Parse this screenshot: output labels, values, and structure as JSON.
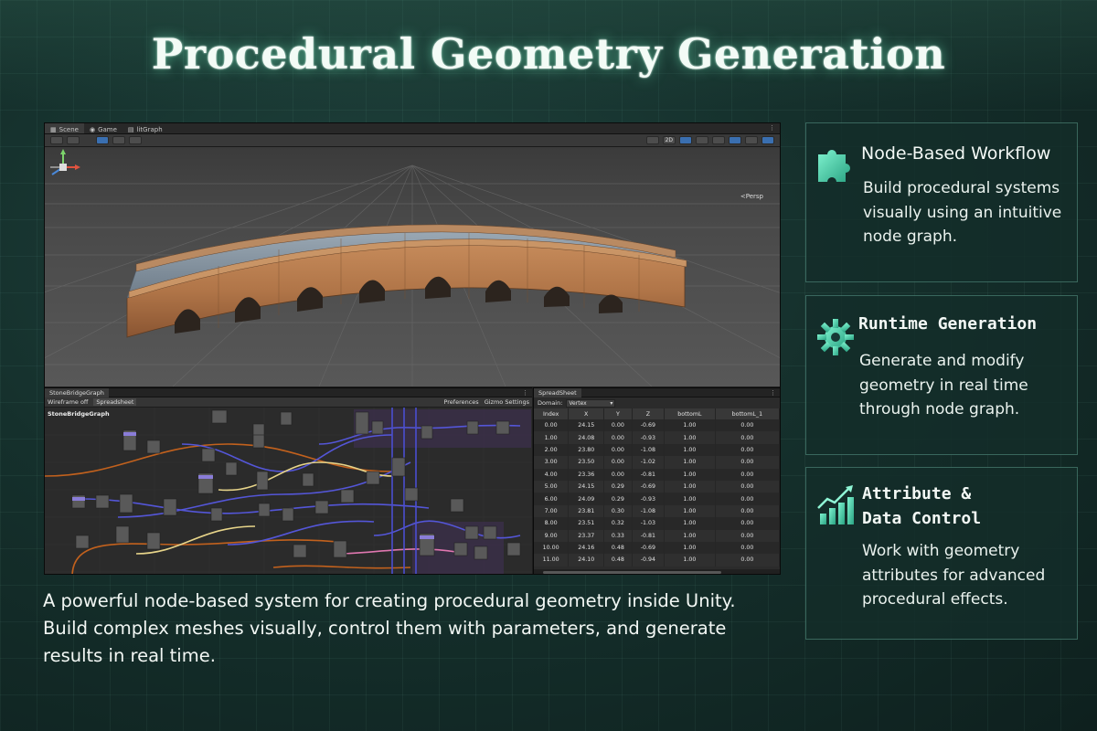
{
  "title": "Procedural Geometry Generation",
  "description": "A powerful node-based system for creating procedural geometry inside Unity. Build complex meshes visually, control them with parameters, and generate results in real time.",
  "editor": {
    "tabs": [
      "Scene",
      "Game",
      "litGraph"
    ],
    "toolbar_2d": "2D",
    "persp_label": "<Persp",
    "graph_panel": {
      "tab": "StoneBridgeGraph",
      "wireframe_label": "Wireframe off",
      "spreadsheet_button": "Spreadsheet",
      "preferences_button": "Preferences",
      "gizmo_settings_button": "Gizmo Settings",
      "graph_name": "StoneBridgeGraph"
    },
    "spreadsheet": {
      "tab": "SpreadSheet",
      "domain_label": "Domain:",
      "domain_value": "Vertex",
      "columns": [
        "Index",
        "X",
        "Y",
        "Z",
        "bottomL",
        "bottomL_1"
      ],
      "rows": [
        [
          "0.00",
          "24.15",
          "0.00",
          "-0.69",
          "1.00",
          "0.00"
        ],
        [
          "1.00",
          "24.08",
          "0.00",
          "-0.93",
          "1.00",
          "0.00"
        ],
        [
          "2.00",
          "23.80",
          "0.00",
          "-1.08",
          "1.00",
          "0.00"
        ],
        [
          "3.00",
          "23.50",
          "0.00",
          "-1.02",
          "1.00",
          "0.00"
        ],
        [
          "4.00",
          "23.36",
          "0.00",
          "-0.81",
          "1.00",
          "0.00"
        ],
        [
          "5.00",
          "24.15",
          "0.29",
          "-0.69",
          "1.00",
          "0.00"
        ],
        [
          "6.00",
          "24.09",
          "0.29",
          "-0.93",
          "1.00",
          "0.00"
        ],
        [
          "7.00",
          "23.81",
          "0.30",
          "-1.08",
          "1.00",
          "0.00"
        ],
        [
          "8.00",
          "23.51",
          "0.32",
          "-1.03",
          "1.00",
          "0.00"
        ],
        [
          "9.00",
          "23.37",
          "0.33",
          "-0.81",
          "1.00",
          "0.00"
        ],
        [
          "10.00",
          "24.16",
          "0.48",
          "-0.69",
          "1.00",
          "0.00"
        ],
        [
          "11.00",
          "24.10",
          "0.48",
          "-0.94",
          "1.00",
          "0.00"
        ]
      ]
    }
  },
  "cards": [
    {
      "title": "Node-Based Workflow",
      "body": "Build procedural systems visually using an intuitive node graph.",
      "icon": "puzzle-icon"
    },
    {
      "title": "Runtime Generation",
      "body": "Generate and modify geometry in real time through node graph.",
      "icon": "gear-icon"
    },
    {
      "title_line1": "Attribute &",
      "title_line2": "Data Control",
      "body": "Work with geometry attributes for advanced procedural effects.",
      "icon": "chart-icon"
    }
  ],
  "colors": {
    "accent": "#6fe0c0",
    "card_border": "#5aa894",
    "background": "#15302c"
  }
}
